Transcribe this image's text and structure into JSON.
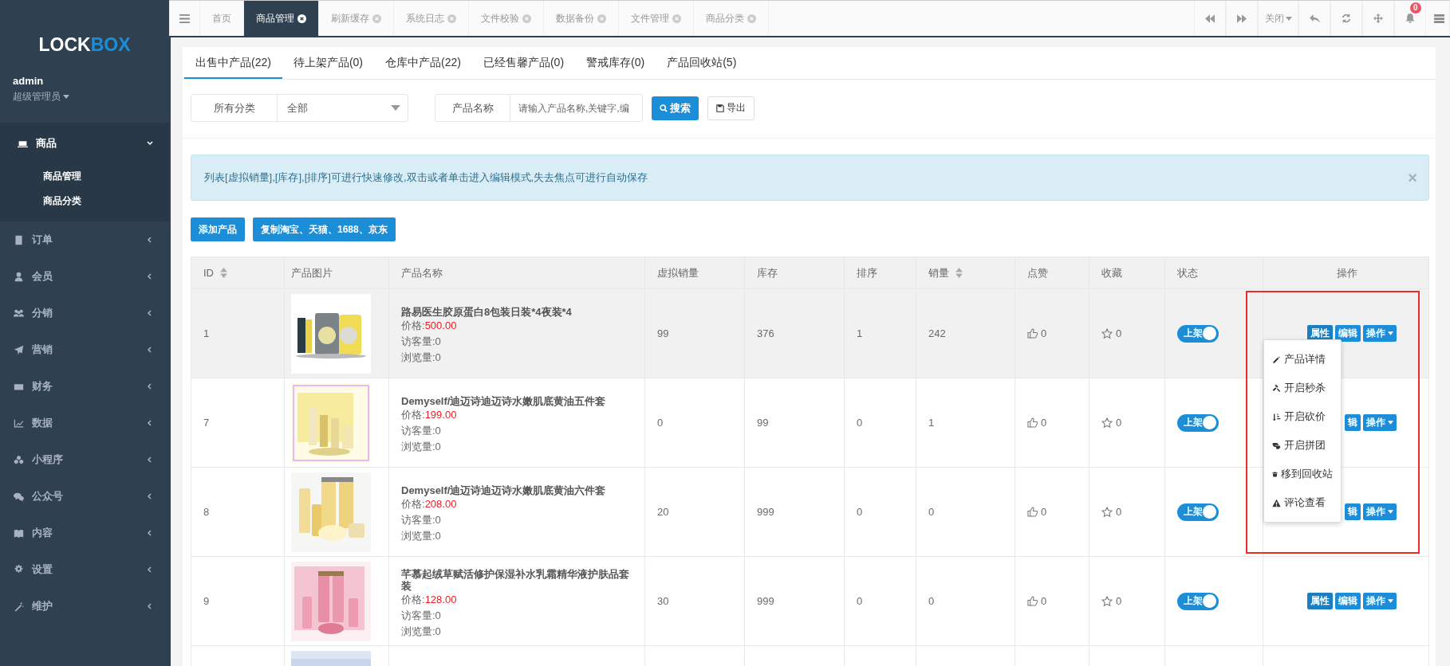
{
  "sidebar": {
    "logo_left": "LOCK",
    "logo_right": "BOX",
    "user": {
      "name": "admin",
      "role": "超级管理员"
    },
    "menu": [
      {
        "label": "商品",
        "expanded": true,
        "children": [
          {
            "label": "商品管理"
          },
          {
            "label": "商品分类"
          }
        ]
      },
      {
        "label": "订单",
        "expanded": false
      },
      {
        "label": "会员",
        "expanded": false
      },
      {
        "label": "分销",
        "expanded": false
      },
      {
        "label": "营销",
        "expanded": false
      },
      {
        "label": "财务",
        "expanded": false
      },
      {
        "label": "数据",
        "expanded": false
      },
      {
        "label": "小程序",
        "expanded": false
      },
      {
        "label": "公众号",
        "expanded": false
      },
      {
        "label": "内容",
        "expanded": false
      },
      {
        "label": "设置",
        "expanded": false
      },
      {
        "label": "维护",
        "expanded": false
      }
    ]
  },
  "top_tabs": [
    {
      "label": "首页",
      "closable": false,
      "selected": false
    },
    {
      "label": "商品管理",
      "closable": true,
      "selected": true
    },
    {
      "label": "刷新缓存",
      "closable": true,
      "selected": false
    },
    {
      "label": "系统日志",
      "closable": true,
      "selected": false
    },
    {
      "label": "文件校验",
      "closable": true,
      "selected": false
    },
    {
      "label": "数据备份",
      "closable": true,
      "selected": false
    },
    {
      "label": "文件管理",
      "closable": true,
      "selected": false
    },
    {
      "label": "商品分类",
      "closable": true,
      "selected": false
    }
  ],
  "toolbar": {
    "close_label": "关闭",
    "notification_count": "0"
  },
  "product_tabs": [
    {
      "label": "出售中产品(22)",
      "selected": true
    },
    {
      "label": "待上架产品(0)",
      "selected": false
    },
    {
      "label": "仓库中产品(22)",
      "selected": false
    },
    {
      "label": "已经售馨产品(0)",
      "selected": false
    },
    {
      "label": "警戒库存(0)",
      "selected": false
    },
    {
      "label": "产品回收站(5)",
      "selected": false
    }
  ],
  "filters": {
    "category_label": "所有分类",
    "category_value": "全部",
    "name_label": "产品名称",
    "name_placeholder": "请输入产品名称,关键字,编",
    "search_button": "搜索",
    "export_button": "导出"
  },
  "notice": {
    "text": "列表[虚拟销量],[库存],[排序]可进行快速修改,双击或者单击进入编辑模式,失去焦点可进行自动保存",
    "close": "×"
  },
  "actions": [
    "添加产品",
    "复制淘宝、天猫、1688、京东"
  ],
  "table": {
    "columns": [
      {
        "label": "ID",
        "sortable": true
      },
      {
        "label": "产品图片",
        "sortable": false
      },
      {
        "label": "产品名称",
        "sortable": false
      },
      {
        "label": "虚拟销量",
        "sortable": false
      },
      {
        "label": "库存",
        "sortable": false
      },
      {
        "label": "排序",
        "sortable": false
      },
      {
        "label": "销量",
        "sortable": true
      },
      {
        "label": "点赞",
        "sortable": false
      },
      {
        "label": "收藏",
        "sortable": false
      },
      {
        "label": "状态",
        "sortable": false
      },
      {
        "label": "操作",
        "sortable": false
      }
    ],
    "rows": [
      {
        "kind": "full",
        "selected": true,
        "id": "1",
        "name": "路易医生胶原蛋白8包装日装*4夜装*4",
        "price_label": "价格:",
        "price": "500.00",
        "visitors": "访客量:0",
        "views": "浏览量:0",
        "virtual_sales": "99",
        "stock": "376",
        "sort": "1",
        "sales": "242",
        "likes": "0",
        "favorites": "0",
        "status": "上架",
        "on": true,
        "buttons": [
          "属性",
          "编辑",
          "操作"
        ]
      },
      {
        "kind": "full",
        "selected": false,
        "id": "7",
        "name": "Demyself/迪迈诗迪迈诗水嫩肌底黄油五件套",
        "price_label": "价格:",
        "price": "199.00",
        "visitors": "访客量:0",
        "views": "浏览量:0",
        "virtual_sales": "0",
        "stock": "99",
        "sort": "0",
        "sales": "1",
        "likes": "0",
        "favorites": "0",
        "status": "上架",
        "on": true,
        "buttons": [
          "辑",
          "操作"
        ]
      },
      {
        "kind": "full",
        "selected": false,
        "id": "8",
        "name": "Demyself/迪迈诗迪迈诗水嫩肌底黄油六件套",
        "price_label": "价格:",
        "price": "208.00",
        "visitors": "访客量:0",
        "views": "浏览量:0",
        "virtual_sales": "20",
        "stock": "999",
        "sort": "0",
        "sales": "0",
        "likes": "0",
        "favorites": "0",
        "status": "上架",
        "on": true,
        "buttons": [
          "辑",
          "操作"
        ]
      },
      {
        "kind": "full",
        "selected": false,
        "id": "9",
        "name": "芊慕起绒草赋活修护保湿补水乳霜精华液护肤品套装",
        "price_label": "价格:",
        "price": "128.00",
        "visitors": "访客量:0",
        "views": "浏览量:0",
        "virtual_sales": "30",
        "stock": "999",
        "sort": "0",
        "sales": "0",
        "likes": "0",
        "favorites": "0",
        "status": "上架",
        "on": true,
        "buttons": [
          "属性",
          "编辑",
          "操作"
        ]
      },
      {
        "kind": "cut"
      }
    ]
  },
  "row_menu": {
    "items": [
      "产品详情",
      "开启秒杀",
      "开启砍价",
      "开启拼团",
      "移到回收站",
      "评论查看"
    ],
    "highlighted": true
  }
}
